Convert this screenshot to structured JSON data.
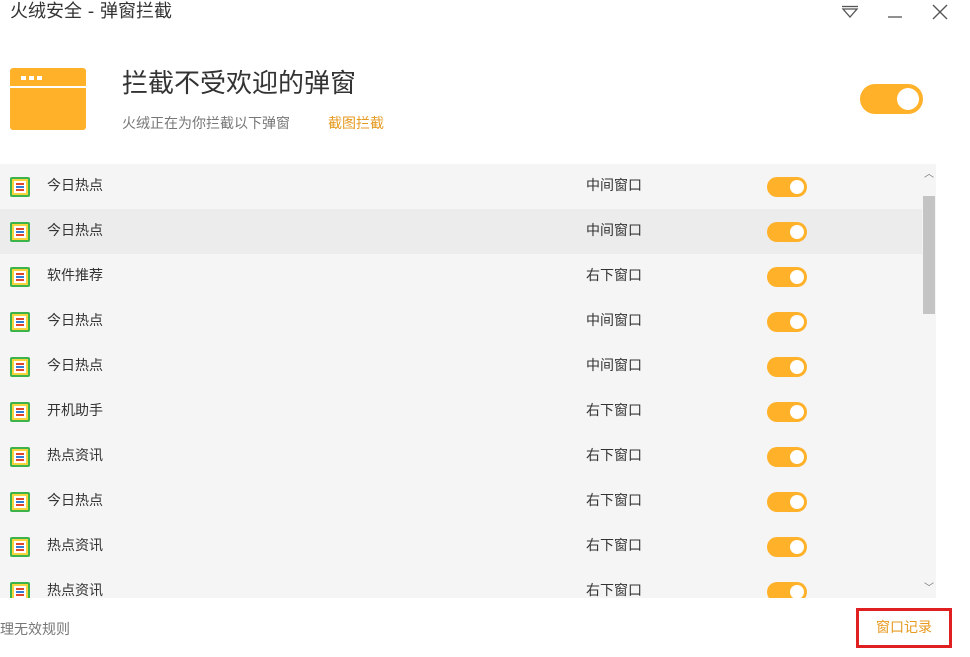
{
  "window": {
    "title": "火绒安全 - 弹窗拦截",
    "controls": [
      "menu-triangle-icon",
      "minimize-icon",
      "close-icon"
    ]
  },
  "header": {
    "headline": "拦截不受欢迎的弹窗",
    "subtitle": "火绒正在为你拦截以下弹窗",
    "screenshot_link": "截图拦截",
    "master_toggle_on": true
  },
  "colors": {
    "accent": "#ffb12a",
    "link": "#e69a20",
    "highlight_border": "#e02020"
  },
  "rows": [
    {
      "name": "今日热点",
      "position": "中间窗口",
      "enabled": true
    },
    {
      "name": "今日热点",
      "position": "中间窗口",
      "enabled": true
    },
    {
      "name": "软件推荐",
      "position": "右下窗口",
      "enabled": true
    },
    {
      "name": "今日热点",
      "position": "中间窗口",
      "enabled": true
    },
    {
      "name": "今日热点",
      "position": "中间窗口",
      "enabled": true
    },
    {
      "name": "开机助手",
      "position": "右下窗口",
      "enabled": true
    },
    {
      "name": "热点资讯",
      "position": "右下窗口",
      "enabled": true
    },
    {
      "name": "今日热点",
      "position": "右下窗口",
      "enabled": true
    },
    {
      "name": "热点资讯",
      "position": "右下窗口",
      "enabled": true
    },
    {
      "name": "热点资讯",
      "position": "右下窗口",
      "enabled": true
    }
  ],
  "footer": {
    "clear_rules_label": "理无效规则",
    "record_button_label": "窗口记录"
  }
}
